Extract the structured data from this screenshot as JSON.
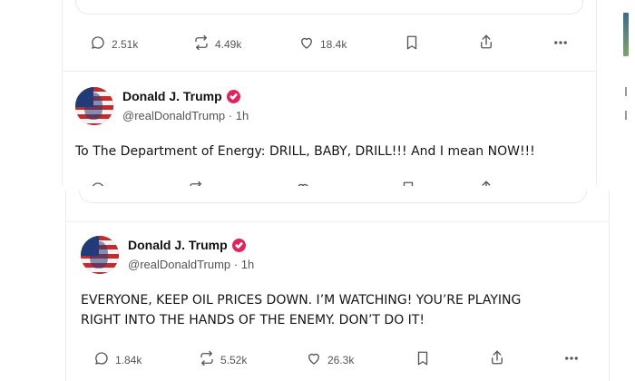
{
  "top_post_prev": {
    "actions": {
      "replies": "2.51k",
      "reposts": "4.49k",
      "likes": "18.4k"
    }
  },
  "posts": [
    {
      "display_name": "Donald J. Trump",
      "handle": "@realDonaldTrump",
      "age": "1h",
      "text": "To The Department of Energy: DRILL, BABY, DRILL!!!  And I mean NOW!!!"
    },
    {
      "display_name": "Donald J. Trump",
      "handle": "@realDonaldTrump",
      "age": "1h",
      "text_lines": [
        "EVERYONE, KEEP OIL PRICES DOWN. I’M WATCHING! YOU’RE PLAYING",
        "RIGHT INTO THE HANDS OF THE ENEMY. DON’T DO IT!"
      ],
      "actions": {
        "replies": "1.84k",
        "reposts": "5.52k",
        "likes": "26.3k"
      }
    }
  ],
  "icons": {
    "reply": "speech-bubble-icon",
    "repost": "repost-arrows-icon",
    "like": "heart-icon",
    "bookmark": "bookmark-icon",
    "share": "share-icon",
    "more": "more-dots-icon",
    "verified": "verified-badge-icon"
  },
  "colors": {
    "verified_badge": "#e0245e",
    "action_gray": "#555555"
  }
}
